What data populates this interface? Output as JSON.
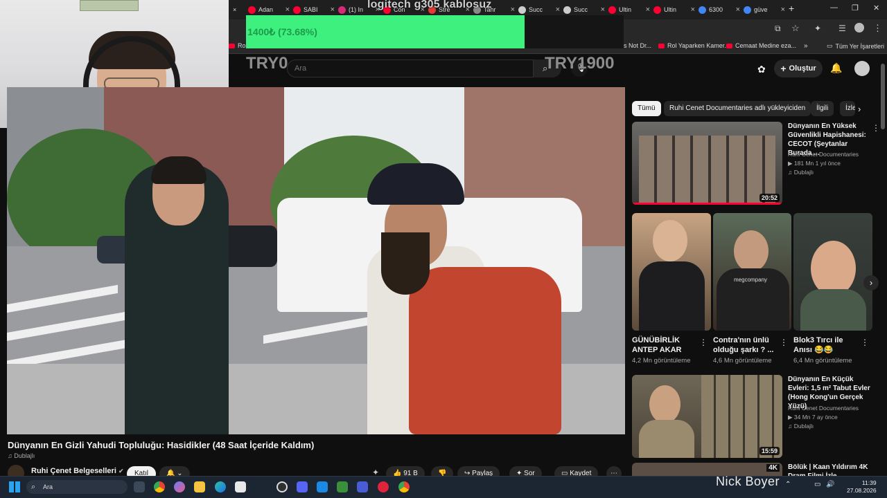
{
  "overlay": {
    "donation_text": "logitech g305 kablosuz",
    "progress_label": "1400₺ (73.68%)",
    "progress_fraction": 0.7368,
    "goal_start": "TRY0",
    "goal_end": "TRY1900"
  },
  "browser": {
    "tabs": [
      {
        "label": "Adan",
        "color": "#ff0033"
      },
      {
        "label": "SABI",
        "color": "#ff0033"
      },
      {
        "label": "(1) In",
        "color": "#d62976"
      },
      {
        "label": "Con",
        "color": "#ff0033"
      },
      {
        "label": "Stre",
        "color": "#e53935"
      },
      {
        "label": "Tahr",
        "color": "#888888"
      },
      {
        "label": "Succ",
        "color": "#cccccc"
      },
      {
        "label": "Succ",
        "color": "#cccccc"
      },
      {
        "label": "Ultin",
        "color": "#ff0033"
      },
      {
        "label": "Ultin",
        "color": "#ff0033"
      },
      {
        "label": "6300",
        "color": "#4285f4"
      },
      {
        "label": "güve",
        "color": "#4285f4"
      }
    ],
    "bookmarks": [
      "Ro",
      "s Not Dr...",
      "Rol Yaparken Kamer...",
      "Cemaat Medine eza...",
      "Tüm Yer İşaretleri"
    ]
  },
  "youtube": {
    "search_placeholder": "Ara",
    "create_label": "Oluştur",
    "video_title": "Dünyanın En Gizli Yahudi Topluluğu: Hasidikler (48 Saat İçeride Kaldım)",
    "dubbed": "Dublajlı",
    "channel_name": "Ruhi Çenet Belgeselleri",
    "join_label": "Katıl",
    "actions": {
      "likes": "91 B",
      "share": "Paylaş",
      "ask": "Sor",
      "save": "Kaydet"
    },
    "categories": [
      "Tümü",
      "Ruhi Cenet Documentaries adlı yükleyiciden",
      "İlgili",
      "İzle"
    ],
    "recommendations": [
      {
        "title": "Dünyanın En Yüksek Güvenlikli Hapishanesi: CECOT (Şeytanlar Burada ...",
        "channel": "Ruhi Cenet Documentaries",
        "meta": "181 Mn  1 yıl önce",
        "badge": "Dublajlı",
        "duration": "20:52"
      },
      {
        "title": "Dünyanın En Küçük Evleri: 1,5 m² Tabut Evler (Hong Kong'un Gerçek Yüzü)",
        "channel": "Ruhi Cenet Documentaries",
        "meta": "34 Mn  7 ay önce",
        "badge": "Dublajlı",
        "duration": "15:59"
      },
      {
        "title": "Bölük | Kaan Yıldırım 4K Dram Filmi İzle",
        "channel": "",
        "meta": "",
        "badge": "",
        "duration": ""
      }
    ],
    "shorts": [
      {
        "title": "GÜNÜBİRLİK ANTEP AKAR",
        "views": "4,2 Mn görüntüleme"
      },
      {
        "title": "Contra'nın ünlü olduğu şarkı ? ...",
        "views": "4,6 Mn görüntüleme"
      },
      {
        "title": "Blok3 Tırcı ile Anısı 😂😂",
        "views": "6,4 Mn görüntüleme"
      }
    ],
    "short_overlay": "megcompany"
  },
  "taskbar": {
    "search_placeholder": "Ara",
    "time": "11:39",
    "date": "27.08.2026",
    "streamer_name": "Nick Boyer"
  }
}
